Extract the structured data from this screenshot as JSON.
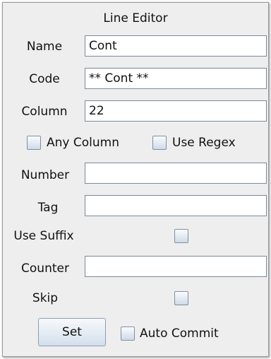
{
  "title": "Line Editor",
  "fields": {
    "name": {
      "label": "Name",
      "value": "Cont"
    },
    "code": {
      "label": "Code",
      "value": "** Cont **"
    },
    "column": {
      "label": "Column",
      "value": "22"
    },
    "number": {
      "label": "Number",
      "value": ""
    },
    "tag": {
      "label": "Tag",
      "value": ""
    },
    "counter": {
      "label": "Counter",
      "value": ""
    }
  },
  "checkboxes": {
    "any_column": {
      "label": "Any Column",
      "checked": false
    },
    "use_regex": {
      "label": "Use Regex",
      "checked": false
    },
    "use_suffix": {
      "label": "Use Suffix",
      "checked": false
    },
    "skip": {
      "label": "Skip",
      "checked": false
    },
    "auto_commit": {
      "label": "Auto Commit",
      "checked": false
    }
  },
  "buttons": {
    "set": "Set"
  },
  "colors": {
    "panel_background": "#eeeeee",
    "field_border": "#7a8a99",
    "checkbox_border": "#7f8fa5"
  }
}
